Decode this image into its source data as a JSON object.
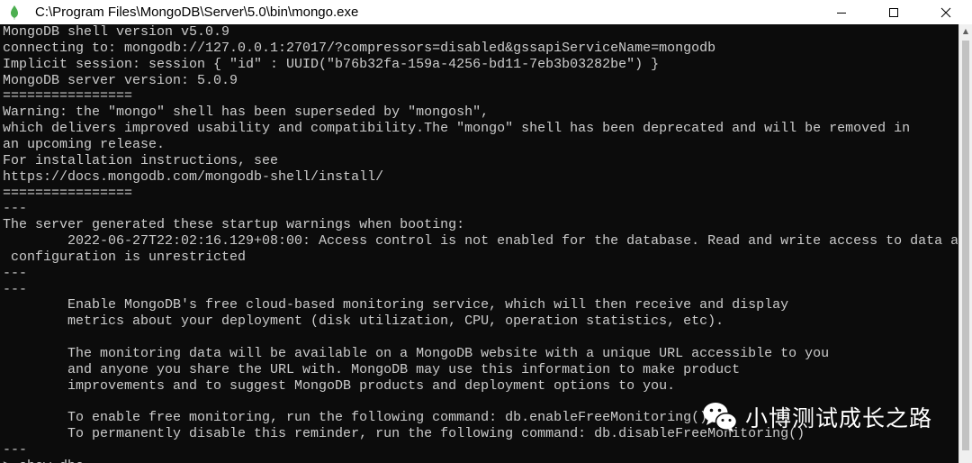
{
  "window": {
    "title": "C:\\Program Files\\MongoDB\\Server\\5.0\\bin\\mongo.exe",
    "icon": "mongodb-leaf-icon",
    "controls": [
      "minimize-icon",
      "maximize-icon",
      "close-icon"
    ]
  },
  "console": {
    "lines": [
      "MongoDB shell version v5.0.9",
      "connecting to: mongodb://127.0.0.1:27017/?compressors=disabled&gssapiServiceName=mongodb",
      "Implicit session: session { \"id\" : UUID(\"b76b32fa-159a-4256-bd11-7eb3b03282be\") }",
      "MongoDB server version: 5.0.9",
      "================",
      "Warning: the \"mongo\" shell has been superseded by \"mongosh\",",
      "which delivers improved usability and compatibility.The \"mongo\" shell has been deprecated and will be removed in",
      "an upcoming release.",
      "For installation instructions, see",
      "https://docs.mongodb.com/mongodb-shell/install/",
      "================",
      "---",
      "The server generated these startup warnings when booting:",
      "        2022-06-27T22:02:16.129+08:00: Access control is not enabled for the database. Read and write access to data and",
      " configuration is unrestricted",
      "---",
      "---",
      "        Enable MongoDB's free cloud-based monitoring service, which will then receive and display",
      "        metrics about your deployment (disk utilization, CPU, operation statistics, etc).",
      "",
      "        The monitoring data will be available on a MongoDB website with a unique URL accessible to you",
      "        and anyone you share the URL with. MongoDB may use this information to make product",
      "        improvements and to suggest MongoDB products and deployment options to you.",
      "",
      "        To enable free monitoring, run the following command: db.enableFreeMonitoring()",
      "        To permanently disable this reminder, run the following command: db.disableFreeMonitoring()",
      "---",
      "> show dbs"
    ]
  },
  "watermark": {
    "icon": "wechat-icon",
    "text": "小博测试成长之路"
  },
  "colors": {
    "console_bg": "#0c0c0c",
    "console_text": "#cccccc",
    "titlebar_bg": "#ffffff",
    "leaf": "#4caf50"
  }
}
